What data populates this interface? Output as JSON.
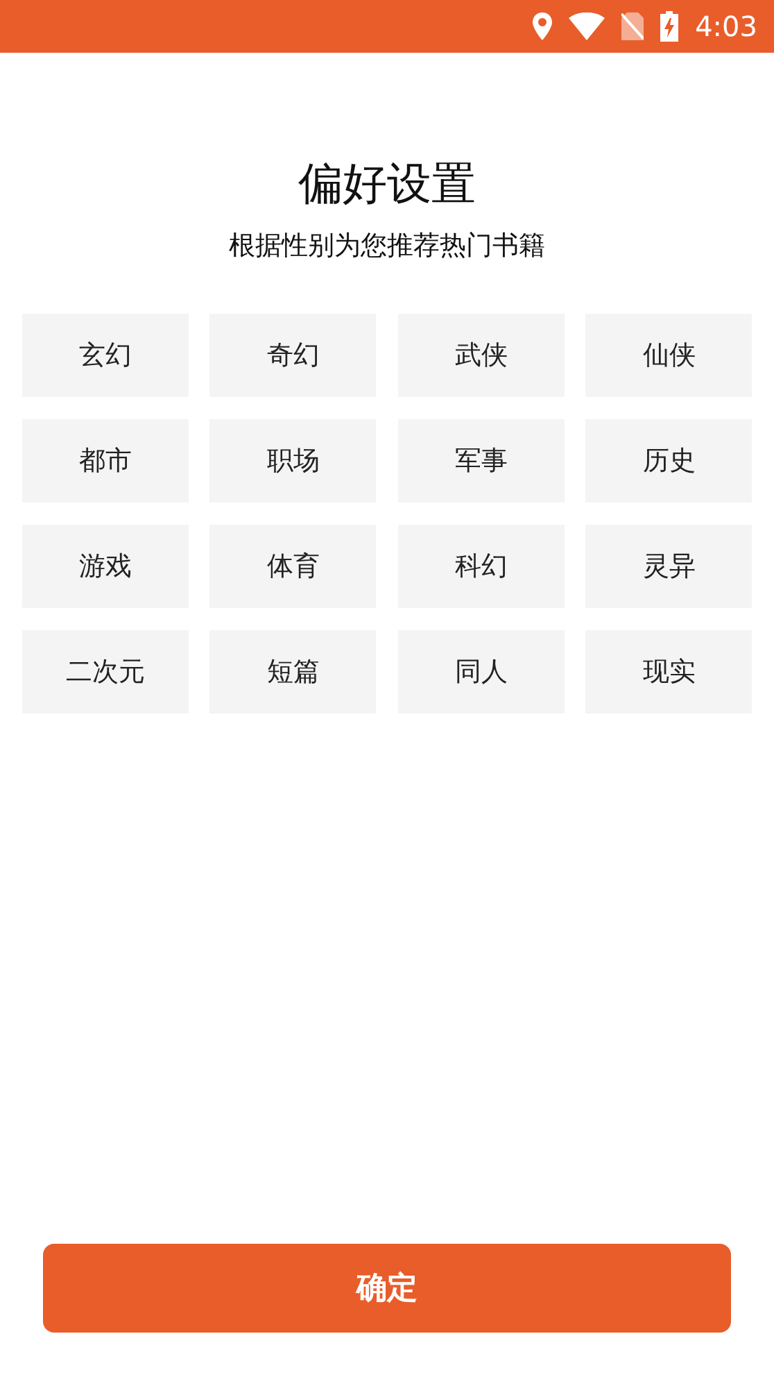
{
  "status_bar": {
    "time": "4:03"
  },
  "title": "偏好设置",
  "subtitle": "根据性别为您推荐热门书籍",
  "tags": [
    {
      "label": "玄幻",
      "selected": false
    },
    {
      "label": "奇幻",
      "selected": false
    },
    {
      "label": "武侠",
      "selected": false
    },
    {
      "label": "仙侠",
      "selected": false
    },
    {
      "label": "都市",
      "selected": false
    },
    {
      "label": "职场",
      "selected": false
    },
    {
      "label": "军事",
      "selected": false
    },
    {
      "label": "历史",
      "selected": false
    },
    {
      "label": "游戏",
      "selected": false
    },
    {
      "label": "体育",
      "selected": false
    },
    {
      "label": "科幻",
      "selected": false
    },
    {
      "label": "灵异",
      "selected": false
    },
    {
      "label": "二次元",
      "selected": false
    },
    {
      "label": "短篇",
      "selected": false
    },
    {
      "label": "同人",
      "selected": false
    },
    {
      "label": "现实",
      "selected": false
    }
  ],
  "confirm_button": "确定"
}
